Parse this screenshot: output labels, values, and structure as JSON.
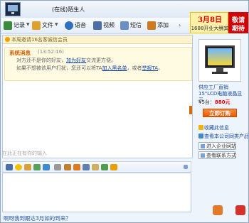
{
  "window": {
    "title_status": "(在线)",
    "title_name": "陌生人"
  },
  "promo": {
    "date": "3月8日",
    "sub": "1688开业大酬宾",
    "tag_line1": "敬请",
    "tag_line2": "期待"
  },
  "toolbar": {
    "items": [
      {
        "label": "记录",
        "icon": "history-icon",
        "color": "#3a8a3a"
      },
      {
        "label": "文件",
        "icon": "file-icon",
        "color": "#e0a030"
      },
      {
        "label": "语音",
        "icon": "voice-icon",
        "color": "#2f6fc0"
      },
      {
        "label": "视频",
        "icon": "video-icon",
        "color": "#4a6fa8"
      },
      {
        "label": "短信",
        "icon": "sms-icon",
        "color": "#6b8fc4"
      },
      {
        "label": "添加",
        "icon": "add-contact-icon",
        "color": "#d07a20"
      }
    ]
  },
  "chat": {
    "notice": "本周邀请16名客诚信会员",
    "system_title": "系统消息",
    "system_time": "(13:52:16)",
    "line1_pre": "对方还不是你的好友，",
    "line1_link": "加为好友",
    "line1_post": "交流更方便。",
    "line2_pre": "如果不想被该用户打扰，您还可以将TA",
    "line2_link1": "加入黑名单",
    "line2_mid": "，或者",
    "line2_link2": "举报TA",
    "line2_post": "。",
    "input_hint": "在此正在有你的输入"
  },
  "bottom_ad": "啊呀我到跟达3月如的到来？",
  "right_panel": {
    "product_desc": "供应工厂直销15\"LCD电脑液晶显示",
    "price_prefix": "¥5台：",
    "price_value": "880元",
    "buy_button": "立即订购",
    "link_favorites": "收藏此信息",
    "link_more_products": "查看本公司同类产品",
    "btn_enterprise": "进入企业网站",
    "btn_contact": "查看联系方式"
  }
}
